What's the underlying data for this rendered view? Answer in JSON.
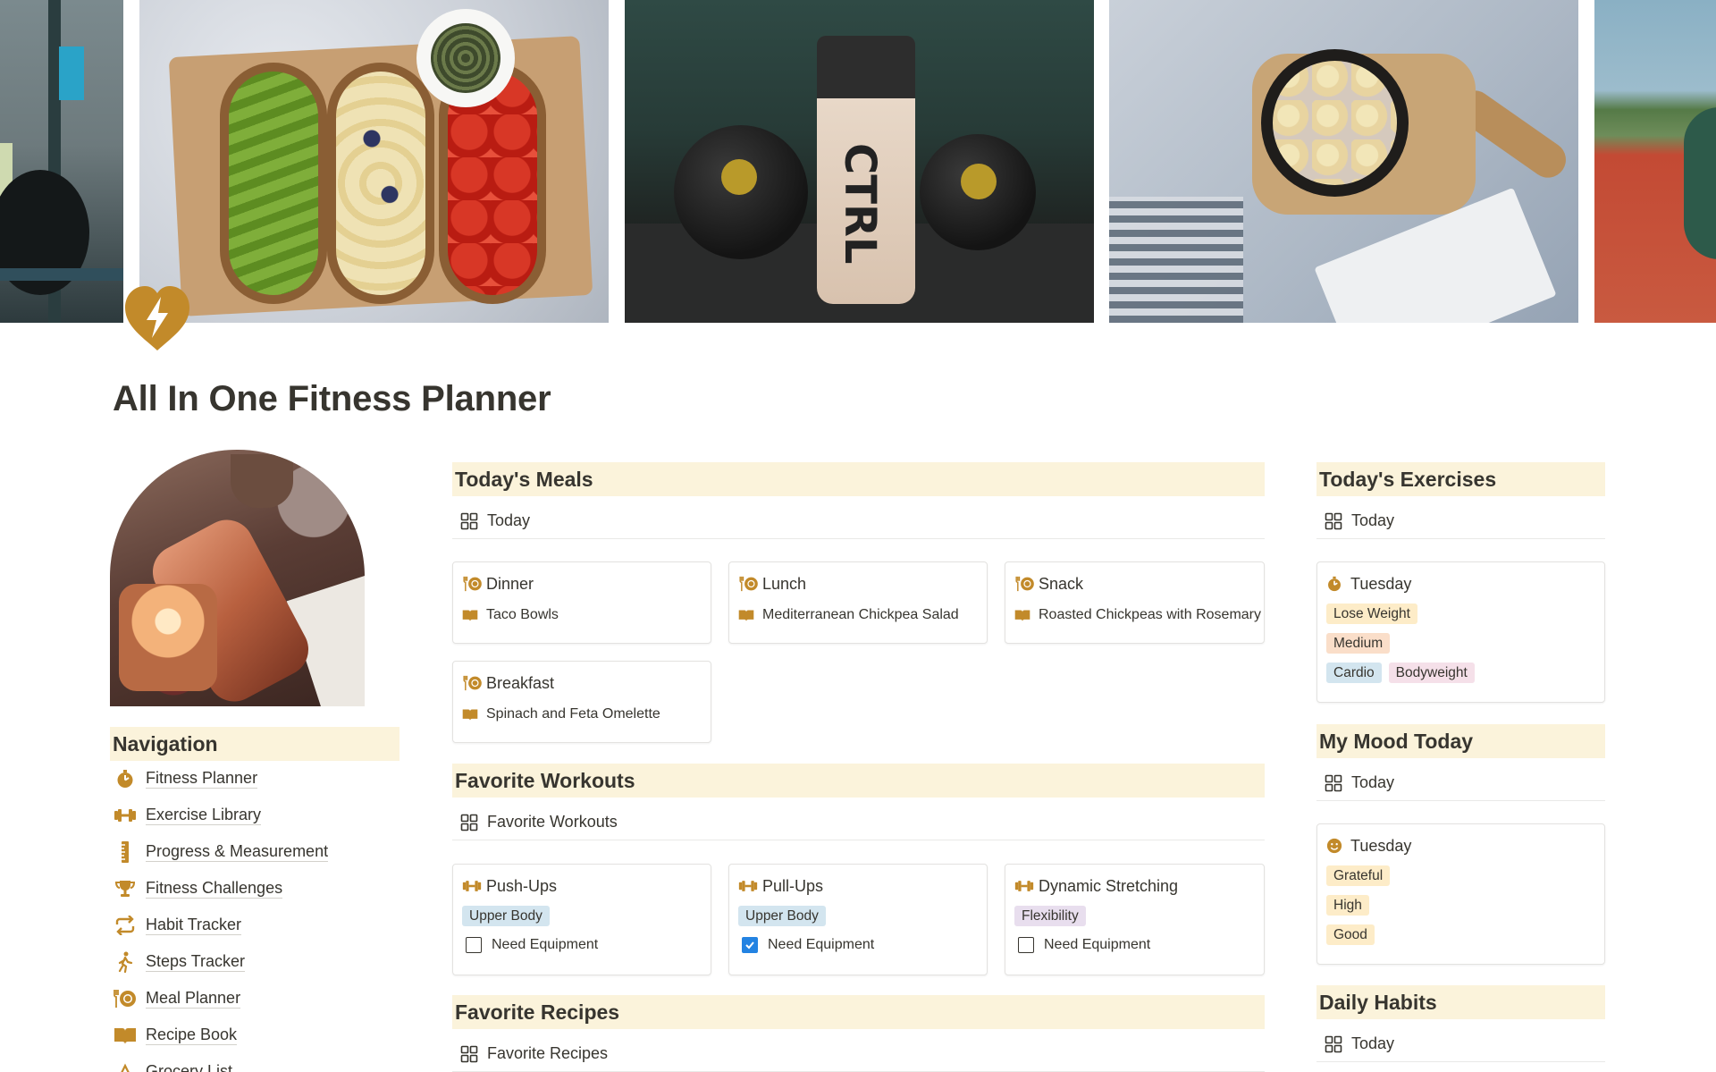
{
  "page": {
    "title": "All In One Fitness Planner",
    "accent_color": "#c28a2a",
    "header_bg_color": "#fbf3db"
  },
  "banner": {
    "photos": [
      "gym-equipment-photo",
      "avocado-banana-tomato-toasts-photo",
      "kettlebells-protein-shaker-photo",
      "oatmeal-bowl-board-photo",
      "running-track-photo"
    ],
    "shaker_text": "CTRL"
  },
  "navigation": {
    "header": "Navigation",
    "items": [
      {
        "label": "Fitness Planner",
        "icon": "stopwatch-icon"
      },
      {
        "label": "Exercise Library",
        "icon": "dumbbell-icon"
      },
      {
        "label": "Progress & Measurement",
        "icon": "ruler-icon"
      },
      {
        "label": "Fitness Challenges",
        "icon": "trophy-icon"
      },
      {
        "label": "Habit Tracker",
        "icon": "repeat-icon"
      },
      {
        "label": "Steps Tracker",
        "icon": "walking-person-icon"
      },
      {
        "label": "Meal Planner",
        "icon": "plate-fork-icon"
      },
      {
        "label": "Recipe Book",
        "icon": "book-icon"
      },
      {
        "label": "Grocery List",
        "icon": "grocery-icon"
      }
    ]
  },
  "meals": {
    "header": "Today's Meals",
    "view_label": "Today",
    "cards": [
      {
        "title": "Dinner",
        "recipe": "Taco Bowls"
      },
      {
        "title": "Lunch",
        "recipe": "Mediterranean Chickpea Salad"
      },
      {
        "title": "Snack",
        "recipe": "Roasted Chickpeas with Rosemary"
      },
      {
        "title": "Breakfast",
        "recipe": "Spinach and Feta Omelette"
      }
    ]
  },
  "workouts": {
    "header": "Favorite Workouts",
    "view_label": "Favorite Workouts",
    "checkbox_label": "Need Equipment",
    "cards": [
      {
        "title": "Push-Ups",
        "tag": "Upper Body",
        "tag_color": "#d3e5ef",
        "need_equipment": false
      },
      {
        "title": "Pull-Ups",
        "tag": "Upper Body",
        "tag_color": "#d3e5ef",
        "need_equipment": true
      },
      {
        "title": "Dynamic Stretching",
        "tag": "Flexibility",
        "tag_color": "#e8deee",
        "need_equipment": false
      }
    ]
  },
  "recipes": {
    "header": "Favorite Recipes",
    "view_label": "Favorite Recipes"
  },
  "exercises": {
    "header": "Today's Exercises",
    "view_label": "Today",
    "card": {
      "title": "Tuesday",
      "goal": "Lose Weight",
      "goal_color": "#fdecc8",
      "intensity": "Medium",
      "intensity_color": "#fadec9",
      "type_tags": [
        {
          "label": "Cardio",
          "color": "#d3e5ef"
        },
        {
          "label": "Bodyweight",
          "color": "#f5e0e9"
        }
      ]
    }
  },
  "mood": {
    "header": "My Mood Today",
    "view_label": "Today",
    "card": {
      "title": "Tuesday",
      "tags": [
        {
          "label": "Grateful",
          "color": "#fdecc8"
        },
        {
          "label": "High",
          "color": "#fdecc8"
        },
        {
          "label": "Good",
          "color": "#fdecc8"
        }
      ]
    }
  },
  "habits": {
    "header": "Daily Habits",
    "view_label": "Today"
  }
}
